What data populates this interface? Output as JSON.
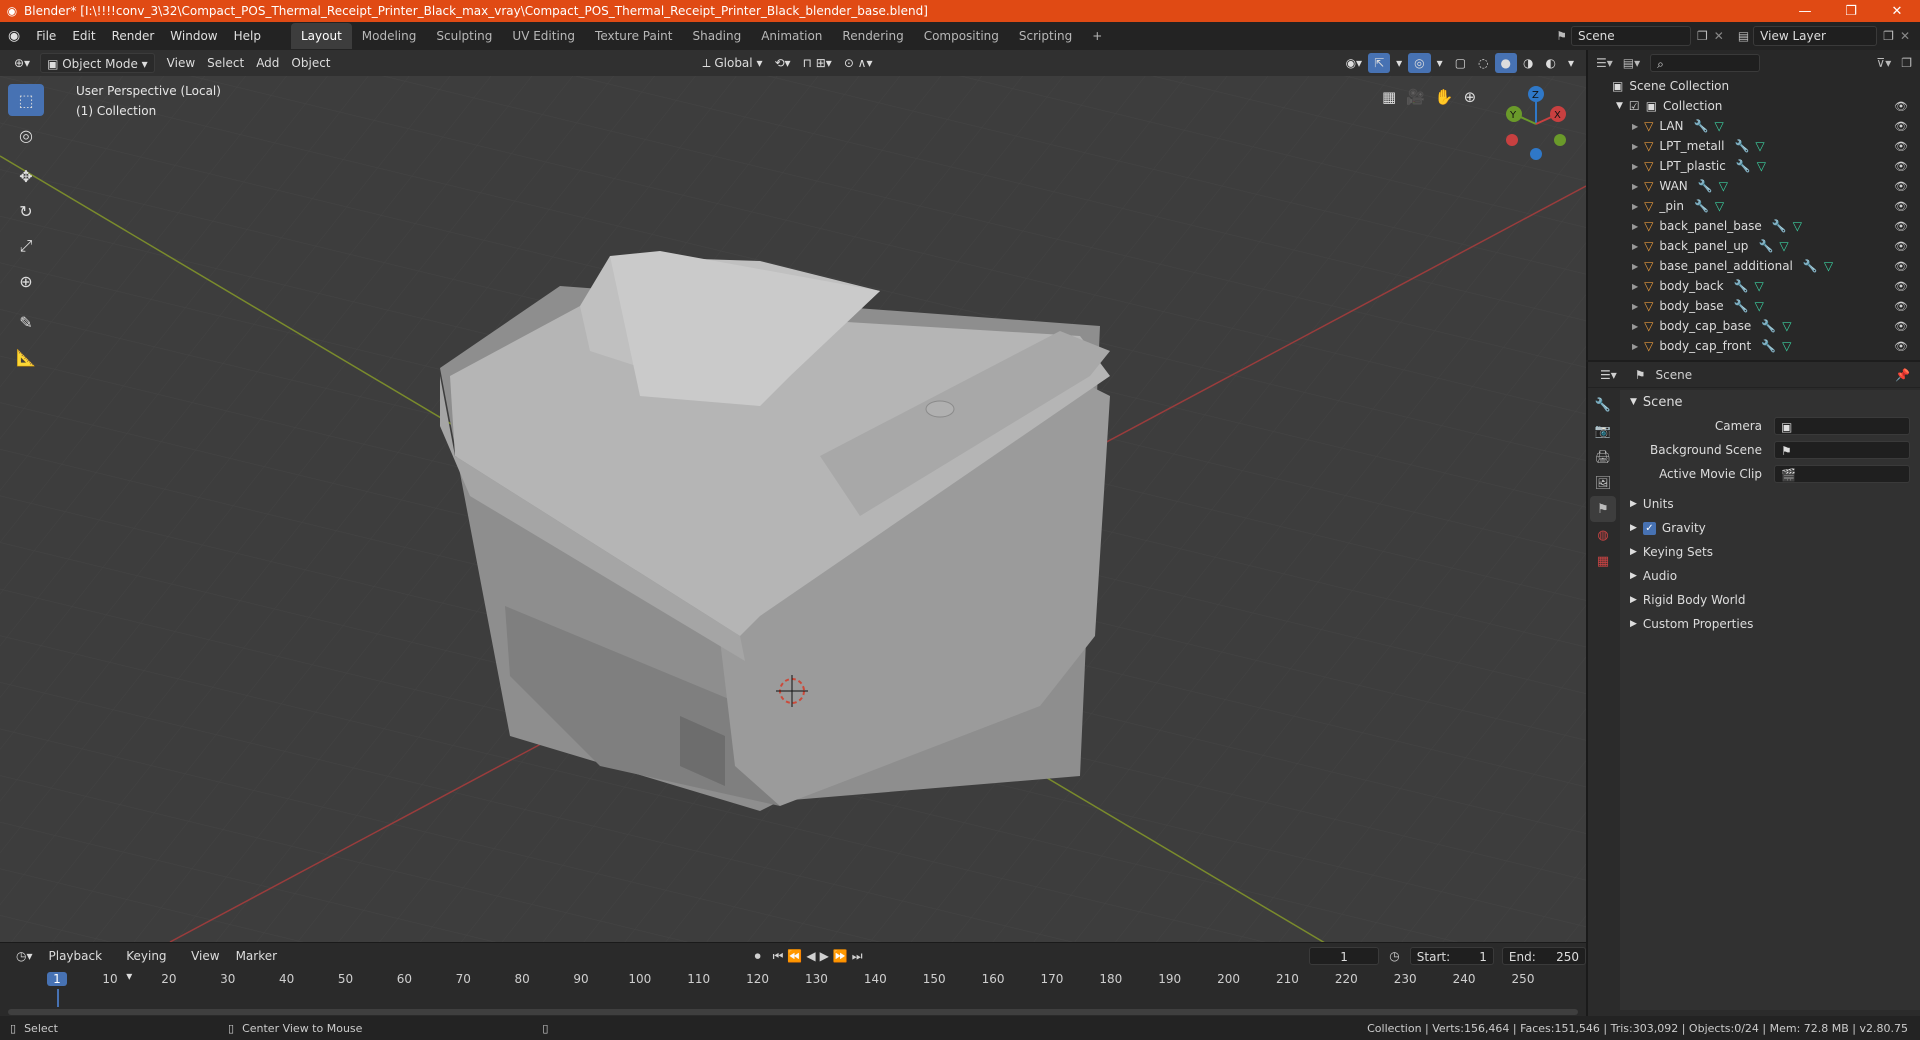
{
  "window": {
    "title": "Blender* [I:\\!!!!conv_3\\32\\Compact_POS_Thermal_Receipt_Printer_Black_max_vray\\Compact_POS_Thermal_Receipt_Printer_Black_blender_base.blend]",
    "minimize": "—",
    "maximize": "❐",
    "close": "✕"
  },
  "menu": [
    "File",
    "Edit",
    "Render",
    "Window",
    "Help"
  ],
  "workspaces": [
    "Layout",
    "Modeling",
    "Sculpting",
    "UV Editing",
    "Texture Paint",
    "Shading",
    "Animation",
    "Rendering",
    "Compositing",
    "Scripting"
  ],
  "active_workspace": "Layout",
  "scene_field": "Scene",
  "viewlayer_field": "View Layer",
  "viewport_header": {
    "mode": "Object Mode",
    "menus": [
      "View",
      "Select",
      "Add",
      "Object"
    ],
    "orientation": "Global"
  },
  "viewport": {
    "perspective": "User Perspective (Local)",
    "collection": "(1) Collection",
    "gizmo": {
      "z": "Z",
      "y": "Y",
      "x": "X"
    }
  },
  "outliner": {
    "root": "Scene Collection",
    "collection": "Collection",
    "items": [
      "LAN",
      "LPT_metall",
      "LPT_plastic",
      "WAN",
      "_pin",
      "back_panel_base",
      "back_panel_up",
      "base_panel_additional",
      "body_back",
      "body_base",
      "body_cap_base",
      "body_cap_front"
    ]
  },
  "properties": {
    "header": "Scene",
    "section": "Scene",
    "camera_label": "Camera",
    "background_scene_label": "Background Scene",
    "active_clip_label": "Active Movie Clip",
    "panels": [
      "Units",
      "Gravity",
      "Keying Sets",
      "Audio",
      "Rigid Body World",
      "Custom Properties"
    ]
  },
  "timeline": {
    "menus": [
      "Playback",
      "Keying",
      "View",
      "Marker"
    ],
    "current_frame": "1",
    "start_label": "Start:",
    "start": "1",
    "end_label": "End:",
    "end": "250",
    "ticks": [
      "1",
      "10",
      "20",
      "30",
      "40",
      "50",
      "60",
      "70",
      "80",
      "90",
      "100",
      "110",
      "120",
      "130",
      "140",
      "150",
      "160",
      "170",
      "180",
      "190",
      "200",
      "210",
      "220",
      "230",
      "240",
      "250"
    ]
  },
  "statusbar": {
    "left": "Select",
    "middle": "Center View to Mouse",
    "right": "Collection | Verts:156,464 | Faces:151,546 | Tris:303,092 | Objects:0/24 | Mem: 72.8 MB | v2.80.75"
  }
}
